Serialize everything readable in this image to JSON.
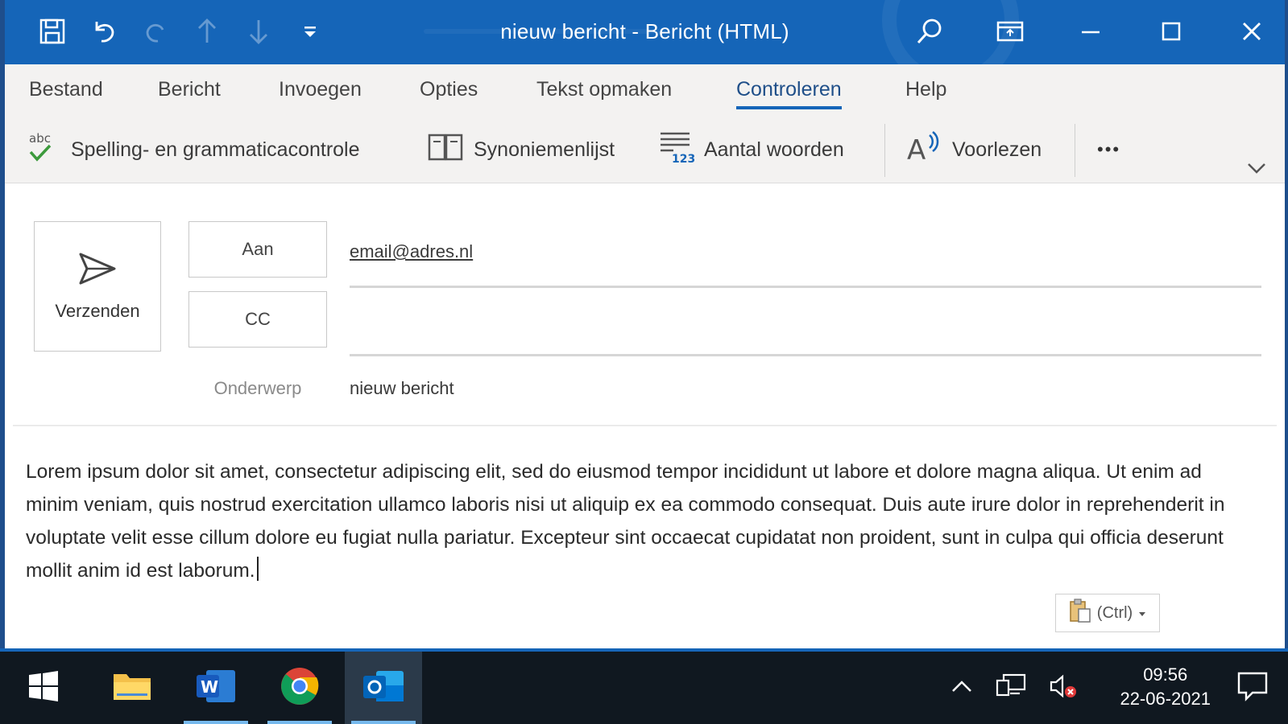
{
  "window": {
    "title": "nieuw bericht  -  Bericht (HTML)"
  },
  "tabs": [
    {
      "label": "Bestand"
    },
    {
      "label": "Bericht"
    },
    {
      "label": "Invoegen"
    },
    {
      "label": "Opties"
    },
    {
      "label": "Tekst opmaken"
    },
    {
      "label": "Controleren",
      "active": true
    },
    {
      "label": "Help"
    }
  ],
  "ribbon": {
    "spelling": "Spelling- en grammaticacontrole",
    "thesaurus": "Synoniemenlijst",
    "wordcount": "Aantal woorden",
    "readaloud": "Voorlezen",
    "more": "•••"
  },
  "compose": {
    "send_label": "Verzenden",
    "to_label": "Aan",
    "cc_label": "CC",
    "to_value": "email@adres.nl",
    "cc_value": "",
    "subject_label": "Onderwerp",
    "subject_value": "nieuw bericht",
    "body": "Lorem ipsum dolor sit amet, consectetur adipiscing elit, sed do eiusmod tempor incididunt ut labore et dolore magna aliqua. Ut enim ad minim veniam, quis nostrud exercitation ullamco laboris nisi ut aliquip ex ea commodo consequat. Duis aute irure dolor in reprehenderit in voluptate velit esse cillum dolore eu fugiat nulla pariatur. Excepteur sint occaecat cupidatat non proident, sunt in culpa qui officia deserunt mollit anim id est laborum.",
    "paste_label": "(Ctrl)"
  },
  "taskbar": {
    "time": "09:56",
    "date": "22-06-2021"
  },
  "colors": {
    "titlebar": "#1565b8",
    "ribbon_bg": "#f3f2f1",
    "taskbar": "#101820"
  }
}
